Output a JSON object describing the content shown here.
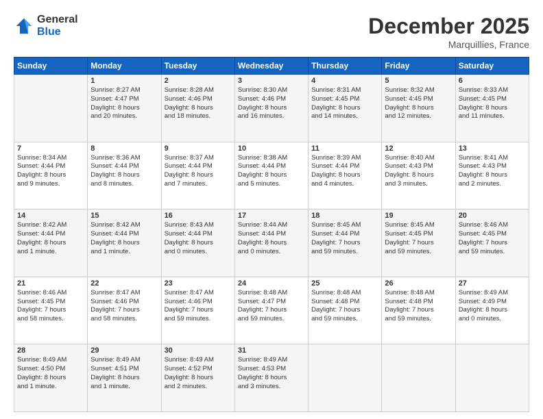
{
  "header": {
    "logo": {
      "general": "General",
      "blue": "Blue"
    },
    "title": "December 2025",
    "location": "Marquillies, France"
  },
  "weekdays": [
    "Sunday",
    "Monday",
    "Tuesday",
    "Wednesday",
    "Thursday",
    "Friday",
    "Saturday"
  ],
  "weeks": [
    [
      {
        "day": "",
        "info": ""
      },
      {
        "day": "1",
        "info": "Sunrise: 8:27 AM\nSunset: 4:47 PM\nDaylight: 8 hours\nand 20 minutes."
      },
      {
        "day": "2",
        "info": "Sunrise: 8:28 AM\nSunset: 4:46 PM\nDaylight: 8 hours\nand 18 minutes."
      },
      {
        "day": "3",
        "info": "Sunrise: 8:30 AM\nSunset: 4:46 PM\nDaylight: 8 hours\nand 16 minutes."
      },
      {
        "day": "4",
        "info": "Sunrise: 8:31 AM\nSunset: 4:45 PM\nDaylight: 8 hours\nand 14 minutes."
      },
      {
        "day": "5",
        "info": "Sunrise: 8:32 AM\nSunset: 4:45 PM\nDaylight: 8 hours\nand 12 minutes."
      },
      {
        "day": "6",
        "info": "Sunrise: 8:33 AM\nSunset: 4:45 PM\nDaylight: 8 hours\nand 11 minutes."
      }
    ],
    [
      {
        "day": "7",
        "info": "Sunrise: 8:34 AM\nSunset: 4:44 PM\nDaylight: 8 hours\nand 9 minutes."
      },
      {
        "day": "8",
        "info": "Sunrise: 8:36 AM\nSunset: 4:44 PM\nDaylight: 8 hours\nand 8 minutes."
      },
      {
        "day": "9",
        "info": "Sunrise: 8:37 AM\nSunset: 4:44 PM\nDaylight: 8 hours\nand 7 minutes."
      },
      {
        "day": "10",
        "info": "Sunrise: 8:38 AM\nSunset: 4:44 PM\nDaylight: 8 hours\nand 5 minutes."
      },
      {
        "day": "11",
        "info": "Sunrise: 8:39 AM\nSunset: 4:44 PM\nDaylight: 8 hours\nand 4 minutes."
      },
      {
        "day": "12",
        "info": "Sunrise: 8:40 AM\nSunset: 4:43 PM\nDaylight: 8 hours\nand 3 minutes."
      },
      {
        "day": "13",
        "info": "Sunrise: 8:41 AM\nSunset: 4:43 PM\nDaylight: 8 hours\nand 2 minutes."
      }
    ],
    [
      {
        "day": "14",
        "info": "Sunrise: 8:42 AM\nSunset: 4:44 PM\nDaylight: 8 hours\nand 1 minute."
      },
      {
        "day": "15",
        "info": "Sunrise: 8:42 AM\nSunset: 4:44 PM\nDaylight: 8 hours\nand 1 minute."
      },
      {
        "day": "16",
        "info": "Sunrise: 8:43 AM\nSunset: 4:44 PM\nDaylight: 8 hours\nand 0 minutes."
      },
      {
        "day": "17",
        "info": "Sunrise: 8:44 AM\nSunset: 4:44 PM\nDaylight: 8 hours\nand 0 minutes."
      },
      {
        "day": "18",
        "info": "Sunrise: 8:45 AM\nSunset: 4:44 PM\nDaylight: 7 hours\nand 59 minutes."
      },
      {
        "day": "19",
        "info": "Sunrise: 8:45 AM\nSunset: 4:45 PM\nDaylight: 7 hours\nand 59 minutes."
      },
      {
        "day": "20",
        "info": "Sunrise: 8:46 AM\nSunset: 4:45 PM\nDaylight: 7 hours\nand 59 minutes."
      }
    ],
    [
      {
        "day": "21",
        "info": "Sunrise: 8:46 AM\nSunset: 4:45 PM\nDaylight: 7 hours\nand 58 minutes."
      },
      {
        "day": "22",
        "info": "Sunrise: 8:47 AM\nSunset: 4:46 PM\nDaylight: 7 hours\nand 58 minutes."
      },
      {
        "day": "23",
        "info": "Sunrise: 8:47 AM\nSunset: 4:46 PM\nDaylight: 7 hours\nand 59 minutes."
      },
      {
        "day": "24",
        "info": "Sunrise: 8:48 AM\nSunset: 4:47 PM\nDaylight: 7 hours\nand 59 minutes."
      },
      {
        "day": "25",
        "info": "Sunrise: 8:48 AM\nSunset: 4:48 PM\nDaylight: 7 hours\nand 59 minutes."
      },
      {
        "day": "26",
        "info": "Sunrise: 8:48 AM\nSunset: 4:48 PM\nDaylight: 7 hours\nand 59 minutes."
      },
      {
        "day": "27",
        "info": "Sunrise: 8:49 AM\nSunset: 4:49 PM\nDaylight: 8 hours\nand 0 minutes."
      }
    ],
    [
      {
        "day": "28",
        "info": "Sunrise: 8:49 AM\nSunset: 4:50 PM\nDaylight: 8 hours\nand 1 minute."
      },
      {
        "day": "29",
        "info": "Sunrise: 8:49 AM\nSunset: 4:51 PM\nDaylight: 8 hours\nand 1 minute."
      },
      {
        "day": "30",
        "info": "Sunrise: 8:49 AM\nSunset: 4:52 PM\nDaylight: 8 hours\nand 2 minutes."
      },
      {
        "day": "31",
        "info": "Sunrise: 8:49 AM\nSunset: 4:53 PM\nDaylight: 8 hours\nand 3 minutes."
      },
      {
        "day": "",
        "info": ""
      },
      {
        "day": "",
        "info": ""
      },
      {
        "day": "",
        "info": ""
      }
    ]
  ]
}
